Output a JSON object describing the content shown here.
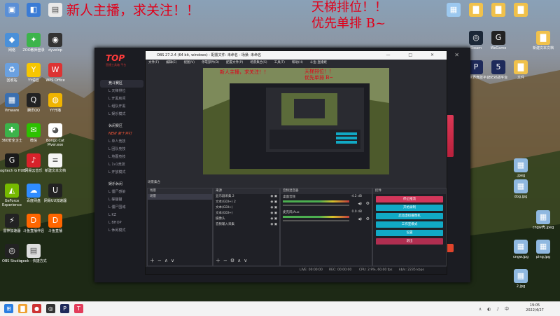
{
  "overlay": {
    "left_text": "新人主播，求关注！！",
    "right_line1": "天梯排位！！",
    "right_line2": "优先单排 B~"
  },
  "desktop_icons_left": [
    {
      "label": "",
      "color": "#5a8fd6",
      "glyph": "▣"
    },
    {
      "label": "",
      "color": "#3a7bd5",
      "glyph": "◧"
    },
    {
      "label": "",
      "color": "#e9e9e9",
      "glyph": "▤"
    },
    {
      "label": "网络",
      "color": "#4a90d9",
      "glyph": "◆"
    },
    {
      "label": "ZOO教师登录",
      "color": "#3cb44b",
      "glyph": "✦"
    },
    {
      "label": "dyvelop",
      "color": "#333",
      "glyph": "◉"
    },
    {
      "label": "回收站",
      "color": "#6aa0e0",
      "glyph": "♻"
    },
    {
      "label": "YY语音",
      "color": "#f7c600",
      "glyph": "Y"
    },
    {
      "label": "WPS Office",
      "color": "#d33",
      "glyph": "W"
    },
    {
      "label": "Vmware",
      "color": "#3a6fb0",
      "glyph": "▦"
    },
    {
      "label": "腾讯QQ",
      "color": "#222",
      "glyph": "Q"
    },
    {
      "label": "YY开播",
      "color": "#f0b400",
      "glyph": "◍"
    },
    {
      "label": "360安全卫士",
      "color": "#3bb34a",
      "glyph": "✚"
    },
    {
      "label": "微信",
      "color": "#2dc100",
      "glyph": "✉"
    },
    {
      "label": "Bongo Cat Mver.exe",
      "color": "#fff",
      "glyph": "◕"
    },
    {
      "label": "Logitech G HUB",
      "color": "#1a1a1a",
      "glyph": "G"
    },
    {
      "label": "网易云音乐",
      "color": "#d8222a",
      "glyph": "♪"
    },
    {
      "label": "新建文本文档",
      "color": "#f5f5f5",
      "glyph": "≡"
    },
    {
      "label": "GeForce Experience",
      "color": "#76b900",
      "glyph": "◭"
    },
    {
      "label": "百度网盘",
      "color": "#2f8cff",
      "glyph": "☁"
    },
    {
      "label": "网易UU加速器",
      "color": "#222",
      "glyph": "U"
    },
    {
      "label": "雷神加速器",
      "color": "#222",
      "glyph": "⚡"
    },
    {
      "label": "斗鱼直播伴侣",
      "color": "#f60",
      "glyph": "D"
    },
    {
      "label": "斗鱼直播",
      "color": "#f60",
      "glyph": "D"
    },
    {
      "label": "OBS Studio",
      "color": "#222",
      "glyph": "◎"
    },
    {
      "label": "geek - 快捷方式",
      "color": "#ddd",
      "glyph": "▤"
    }
  ],
  "desktop_icons_right": [
    {
      "label": "",
      "color": "#9cc8ef",
      "glyph": "▦"
    },
    {
      "label": "",
      "color": "#f0c14b",
      "glyph": "▇"
    },
    {
      "label": "",
      "color": "#f0c14b",
      "glyph": "▇"
    },
    {
      "label": "",
      "color": "#f0c14b",
      "glyph": "▇"
    },
    {
      "label": "Steam",
      "color": "#1b2838",
      "glyph": "◎"
    },
    {
      "label": "WeGame",
      "color": "#222",
      "glyph": "G"
    },
    {
      "label": "新建文本文档",
      "color": "#f0c14b",
      "glyph": "▇"
    },
    {
      "label": "完美世界竞技平台",
      "color": "#1e2a5a",
      "glyph": "P"
    },
    {
      "label": "5E对战平台",
      "color": "#1e2a5a",
      "glyph": "5"
    },
    {
      "label": "文件",
      "color": "#f0c14b",
      "glyph": "▇"
    },
    {
      "label": ".jpeg",
      "color": "#8fb8e0",
      "glyph": "▦"
    },
    {
      "label": "dog.jpg",
      "color": "#8fb8e0",
      "glyph": "▦"
    },
    {
      "label": "cngw壳.jpeg",
      "color": "#8fb8e0",
      "glyph": "▦"
    },
    {
      "label": "cngw.jpg",
      "color": "#8fb8e0",
      "glyph": "▦"
    },
    {
      "label": "ping.jpg",
      "color": "#8fb8e0",
      "glyph": "▦"
    },
    {
      "label": "2.jpg",
      "color": "#8fb8e0",
      "glyph": "▦"
    }
  ],
  "client": {
    "logo": "TOP",
    "subtitle": "直播工具箱 平台",
    "window_controls": "— □ ✕",
    "menu": [
      {
        "label": "竞斗赛区",
        "cls": "main active"
      },
      {
        "label": "L 天梯排位",
        "cls": ""
      },
      {
        "label": "L 开黑房间",
        "cls": ""
      },
      {
        "label": "L 组队开黑",
        "cls": ""
      },
      {
        "label": "L 娱乐模式",
        "cls": ""
      },
      {
        "label": "休闲赛区",
        "cls": "main"
      },
      {
        "label": "NEW 新十开打",
        "cls": "hot"
      },
      {
        "label": "L 单人竞技",
        "cls": ""
      },
      {
        "label": "L 团队竞技",
        "cls": ""
      },
      {
        "label": "L 地图竞技",
        "cls": ""
      },
      {
        "label": "L 1v1竞技",
        "cls": ""
      },
      {
        "label": "L 开放模式",
        "cls": ""
      },
      {
        "label": "娱乐休闲",
        "cls": "main"
      },
      {
        "label": "L 僵尸感染",
        "cls": ""
      },
      {
        "label": "L 躲猫猫",
        "cls": ""
      },
      {
        "label": "L 僵尸围城",
        "cls": ""
      },
      {
        "label": "L KZ",
        "cls": ""
      },
      {
        "label": "L BHOP",
        "cls": ""
      },
      {
        "label": "L 休闲模式",
        "cls": ""
      }
    ]
  },
  "obs": {
    "title": "OBS 27.2.4 (64 bit, windows) - 配置文件: 未命名 - 场景: 未命名",
    "window_buttons": "— □ ✕",
    "menu": [
      "文件(F)",
      "编辑(E)",
      "视图(V)",
      "停靠部件(D)",
      "配置文件(P)",
      "场景集合(S)",
      "工具(T)",
      "帮助(H)",
      "斗鱼-直播姬"
    ],
    "scene_label": "场景集合",
    "scenes_header": "场景",
    "scenes": [
      "场景"
    ],
    "sources_header": "来源",
    "sources": [
      "显示器采集 2",
      "文本(GDI+) 2",
      "文本(GDI+)",
      "文本(GDI+)",
      "摄像头",
      "音频输入采集"
    ],
    "mixer_header": "音频混音器",
    "mixer": [
      {
        "name": "桌面音频",
        "db": "-4.2 dB"
      },
      {
        "name": "麦克风/Aux",
        "db": "0.0 dB"
      }
    ],
    "controls_header": "控件",
    "controls": [
      {
        "label": "停止推流",
        "color": "#d2365a"
      },
      {
        "label": "开始录制",
        "color": "#11a9c5"
      },
      {
        "label": "启动虚拟摄像机",
        "color": "#11a9c5"
      },
      {
        "label": "工作室模式",
        "color": "#11a9c5"
      },
      {
        "label": "设置",
        "color": "#11a9c5"
      },
      {
        "label": "退出",
        "color": "#b02e50"
      }
    ],
    "status": {
      "live": "LIVE: 00:00:00",
      "rec": "REC: 00:00:00",
      "cpu": "CPU: 2.9%, 60.00 fps",
      "kbps": "kb/s: 2235 kbps"
    }
  },
  "taskbar": {
    "time": "19:05",
    "date": "2022/4/27"
  }
}
